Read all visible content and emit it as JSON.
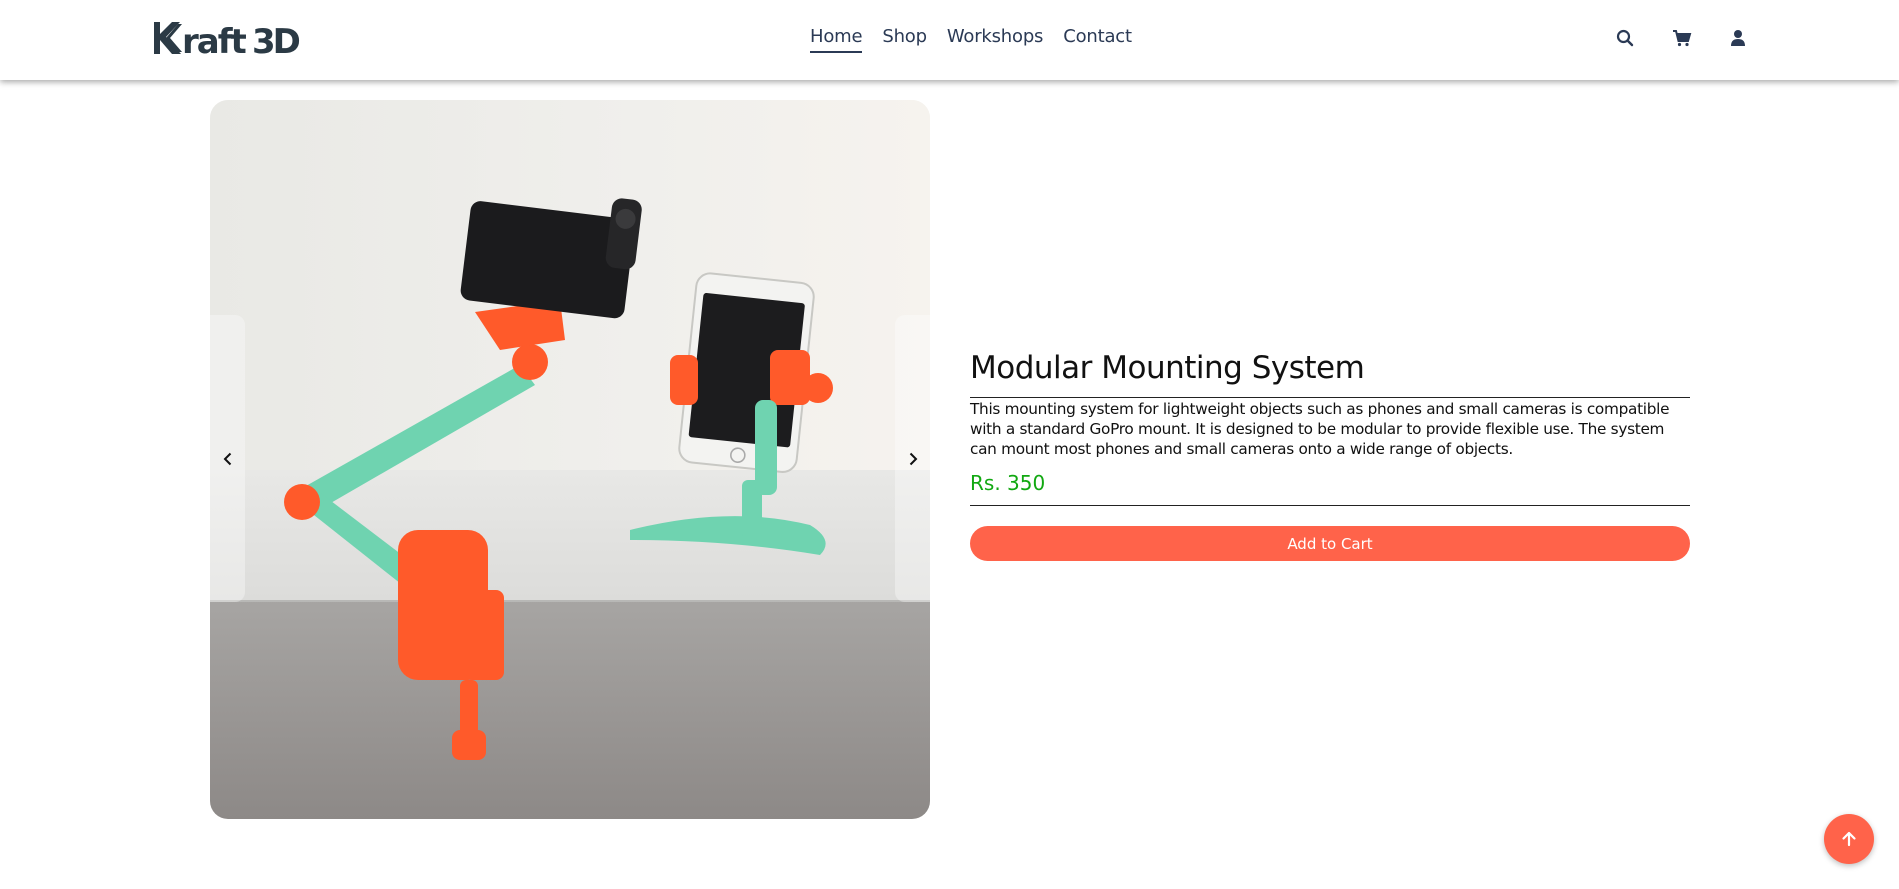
{
  "header": {
    "logo_text": "Kraft3D",
    "nav": [
      {
        "label": "Home",
        "active": true
      },
      {
        "label": "Shop",
        "active": false
      },
      {
        "label": "Workshops",
        "active": false
      },
      {
        "label": "Contact",
        "active": false
      }
    ],
    "icons": [
      "search-icon",
      "cart-icon",
      "user-icon"
    ]
  },
  "product": {
    "title": "Modular Mounting System",
    "description": "This mounting system for lightweight objects such as phones and small cameras is compatible with a standard GoPro mount. It is designed to be modular to provide flexible use. The system can mount most phones and small cameras onto a wide range of objects.",
    "price": "Rs. 350",
    "add_to_cart_label": "Add to Cart"
  },
  "carousel": {
    "prev_icon": "chevron-left-icon",
    "next_icon": "chevron-right-icon"
  },
  "colors": {
    "accent": "#ff634a",
    "price": "#11a811",
    "nav_text": "#2b3a55",
    "mount_teal": "#6fd3b0",
    "mount_orange": "#ff5a2a"
  }
}
